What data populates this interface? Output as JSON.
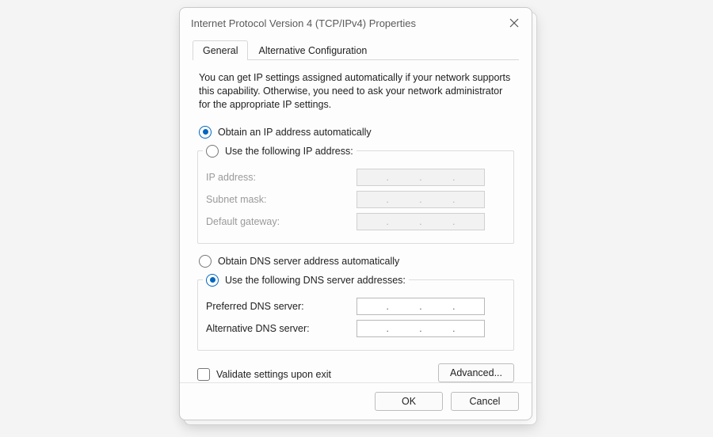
{
  "window": {
    "title": "Internet Protocol Version 4 (TCP/IPv4) Properties"
  },
  "tabs": {
    "general": "General",
    "alternate": "Alternative Configuration"
  },
  "description": "You can get IP settings assigned automatically if your network supports this capability. Otherwise, you need to ask your network administrator for the appropriate IP settings.",
  "ip": {
    "auto_label": "Obtain an IP address automatically",
    "manual_label": "Use the following IP address:",
    "selected": "auto",
    "fields": {
      "ip_address": {
        "label": "IP address:",
        "value": ""
      },
      "subnet_mask": {
        "label": "Subnet mask:",
        "value": ""
      },
      "default_gateway": {
        "label": "Default gateway:",
        "value": ""
      }
    }
  },
  "dns": {
    "auto_label": "Obtain DNS server address automatically",
    "manual_label": "Use the following DNS server addresses:",
    "selected": "manual",
    "fields": {
      "preferred": {
        "label": "Preferred DNS server:",
        "value": ""
      },
      "alternate": {
        "label": "Alternative DNS server:",
        "value": ""
      }
    }
  },
  "validate": {
    "label": "Validate settings upon exit",
    "checked": false
  },
  "buttons": {
    "advanced": "Advanced...",
    "ok": "OK",
    "cancel": "Cancel"
  }
}
